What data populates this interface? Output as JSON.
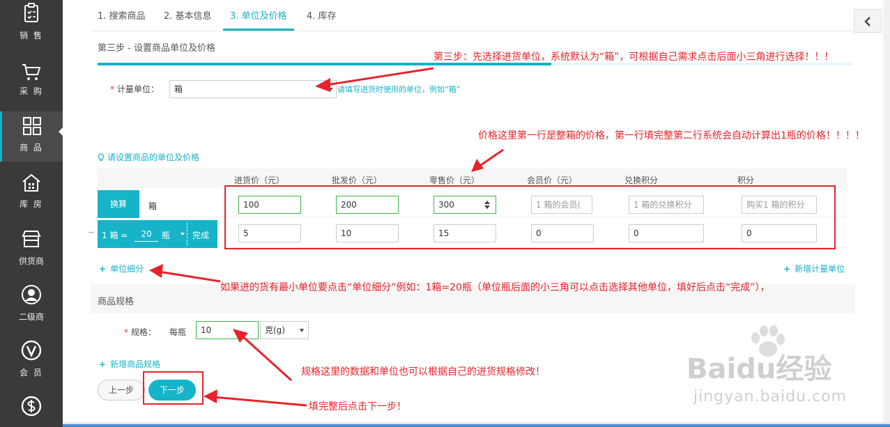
{
  "sidebar": {
    "items": [
      {
        "label": "销 售",
        "icon": "clipboard-icon"
      },
      {
        "label": "采 购",
        "icon": "cart-icon"
      },
      {
        "label": "商 品",
        "icon": "grid-icon"
      },
      {
        "label": "库 房",
        "icon": "warehouse-icon"
      },
      {
        "label": "供货商",
        "icon": "shop-icon"
      },
      {
        "label": "二级商",
        "icon": "person-icon"
      },
      {
        "label": "会 员",
        "icon": "vip-icon"
      },
      {
        "label": "",
        "icon": "dollar-icon"
      }
    ],
    "active_index": 2
  },
  "tabs": [
    {
      "label": "1. 搜索商品"
    },
    {
      "label": "2. 基本信息"
    },
    {
      "label": "3. 单位及价格"
    },
    {
      "label": "4. 库存"
    }
  ],
  "step_title": "第三步 - 设置商品单位及价格",
  "progress_fraction": 0.6,
  "unit": {
    "label": "计量单位：",
    "value": "箱",
    "hint": "请填写进货时使用的单位，例如“箱”"
  },
  "set_tip": "请设置商品的单位及价格",
  "price_table": {
    "headers": [
      "进货价（元）",
      "批发价（元）",
      "零售价（元）",
      "会员价（元）",
      "兑换积分",
      "积分"
    ],
    "convert_label": "换算",
    "base_unit": "箱",
    "row1": [
      "100",
      "200",
      "300"
    ],
    "row1_placeholders": [
      "1 箱的会员(",
      "1 箱的兑换积分",
      "购买1 箱的积分"
    ],
    "sub_prefix": "1  箱 =",
    "sub_qty": "20",
    "sub_unit": "瓶",
    "sub_done": "完成",
    "row2": [
      "5",
      "10",
      "15",
      "0",
      "0",
      "0"
    ]
  },
  "links": {
    "unit_detail": "单位细分",
    "new_unit": "新增计量单位",
    "new_spec": "新增商品规格"
  },
  "spec": {
    "section_title": "商品规格",
    "label": "规格：",
    "prefix": "每瓶",
    "value": "10",
    "unit": "克(g)"
  },
  "buttons": {
    "prev": "上一步",
    "next": "下一步"
  },
  "annotations": {
    "a1": "第三步：先选择进货单位，系统默认为“箱”，可根据自己需求点击后面小三角进行选择！！！",
    "a2": "价格这里第一行是整箱的价格，第一行填完整第二行系统会自动计算出1瓶的价格！！！！",
    "a3": "如果进的货有最小单位要点击“单位细分”例如：1箱=20瓶（单位瓶后面的小三角可以点击选择其他单位，填好后点击“完成”），",
    "a4": "规格这里的数据和单位也可以根据自己的进货规格修改！",
    "a5": "填完整后点击下一步！"
  },
  "watermark": {
    "brand": "Baidu经验",
    "url": "jingyan.baidu.com"
  },
  "colors": {
    "accent": "#17b3c8",
    "sidebar": "#3a3a3a",
    "annotation": "#e8222a",
    "valid_border": "#3bb54a"
  }
}
